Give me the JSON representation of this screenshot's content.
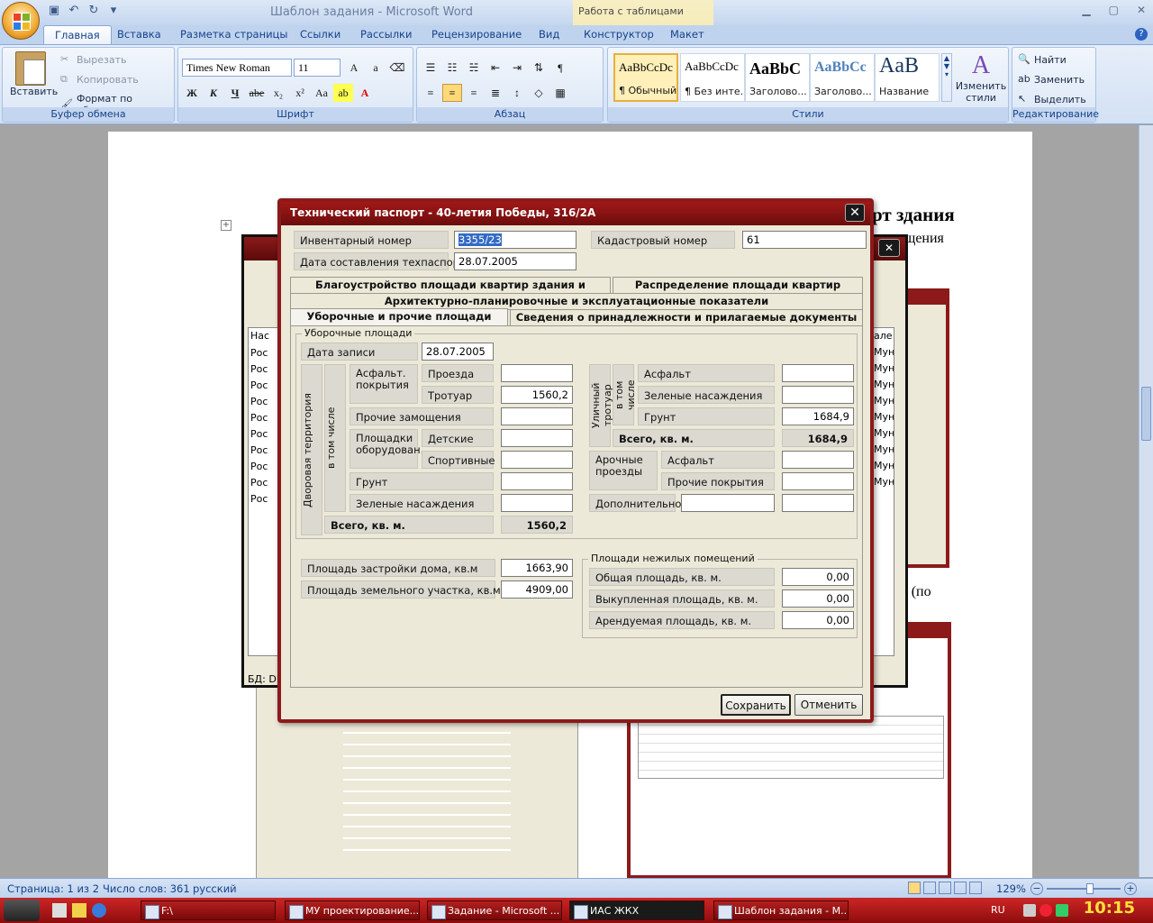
{
  "word": {
    "title": "Шаблон задания - Microsoft Word",
    "context_tab_title": "Работа с таблицами",
    "tabs": [
      "Главная",
      "Вставка",
      "Разметка страницы",
      "Ссылки",
      "Рассылки",
      "Рецензирование",
      "Вид",
      "Конструктор",
      "Макет"
    ],
    "clipboard": {
      "paste": "Вставить",
      "cut": "Вырезать",
      "copy": "Копировать",
      "format_painter": "Формат по образцу",
      "label": "Буфер обмена"
    },
    "font": {
      "name": "Times New Roman",
      "size": "11",
      "bold": "Ж",
      "italic": "К",
      "underline": "Ч",
      "strike": "abe",
      "label": "Шрифт"
    },
    "paragraph": {
      "label": "Абзац"
    },
    "styles": [
      {
        "sample": "AaBbCcDc",
        "name": "¶ Обычный"
      },
      {
        "sample": "AaBbCcDc",
        "name": "¶ Без инте..."
      },
      {
        "sample": "AaBbC",
        "name": "Заголово..."
      },
      {
        "sample": "AaBbCc",
        "name": "Заголово..."
      },
      {
        "sample": "AaB",
        "name": "Название"
      }
    ],
    "styles_label": "Стили",
    "change_styles": "Изменить стили",
    "editing": {
      "find": "Найти",
      "replace": "Заменить",
      "select": "Выделить",
      "label": "Редактирование"
    },
    "doc_fragments": {
      "heading_right": "рт здания",
      "sub_right": "щения",
      "mid_right": "дания (по"
    }
  },
  "dialog": {
    "title": "Технический паспорт - 40-летия Победы, 316/2А",
    "inv_label": "Инвентарный номер",
    "inv_value": "3355/23",
    "cad_label": "Кадастровый номер",
    "cad_value": "61",
    "date_label": "Дата составления техпаспорта",
    "date_value": "28.07.2005",
    "tabs_row1": [
      "Благоустройство площади квартир здания и строения",
      "Распределение площади квартир здания"
    ],
    "tabs_row2": [
      "Архитектурно-планировочные и эксплуатационные показатели"
    ],
    "tabs_row3": [
      "Уборочные и прочие площади",
      "Сведения о принадлежности и прилагаемые документы"
    ],
    "group_title": "Уборочные площади",
    "record_date_label": "Дата записи",
    "record_date_value": "28.07.2005",
    "yard": {
      "vertical": "Дворовая территория",
      "incl": "в том числе",
      "asphalt_group": "Асфальт. покрытия",
      "passages": "Проезда",
      "passages_value": "",
      "sidewalk": "Тротуар",
      "sidewalk_value": "1560,2",
      "other_paving": "Прочие замощения",
      "other_paving_value": "",
      "equipped": "Площадки оборудован.",
      "children": "Детские",
      "children_value": "",
      "sports": "Спортивные",
      "sports_value": "",
      "soil": "Грунт",
      "soil_value": "",
      "green": "Зеленые насаждения",
      "green_value": "",
      "total_label": "Всего, кв. м.",
      "total_value": "1560,2"
    },
    "street": {
      "vertical": "Уличный тротуар",
      "incl": "в том числе",
      "asphalt": "Асфальт",
      "asphalt_value": "",
      "green": "Зеленые насаждения",
      "green_value": "",
      "soil": "Грунт",
      "soil_value": "1684,9",
      "total_label": "Всего, кв. м.",
      "total_value": "1684,9"
    },
    "arch": {
      "label": "Арочные проезды",
      "asphalt": "Асфальт",
      "asphalt_value": "",
      "other": "Прочие покрытия",
      "other_value": ""
    },
    "extra_label": "Дополнительно",
    "extra_value1": "",
    "extra_value2": "",
    "build_area_label": "Площадь застройки дома, кв.м",
    "build_area_value": "1663,90",
    "land_area_label": "Площадь земельного участка, кв.м",
    "land_area_value": "4909,00",
    "nonres": {
      "title": "Площади нежилых помещений",
      "total_label": "Общая площадь, кв. м.",
      "total_value": "0,00",
      "bought_label": "Выкупленная площадь, кв. м.",
      "bought_value": "0,00",
      "rented_label": "Арендуемая площадь, кв. м.",
      "rented_value": "0,00"
    },
    "save": "Сохранить",
    "cancel": "Отменить"
  },
  "bg_window": {
    "col_header": "Нас",
    "row_text": "Рос",
    "right_col_header": "але",
    "right_text": "Муні",
    "db_label": "БД: DB"
  },
  "status": {
    "page": "Страница: 1 из 2",
    "words": "Число слов: 361",
    "lang": "русский",
    "zoom": "129%"
  },
  "taskbar": {
    "items": [
      "F:\\",
      "МУ проектирование...",
      "Задание - Microsoft ...",
      "ИАС ЖКХ",
      "Шаблон задания - M..."
    ],
    "lang": "RU",
    "clock": "10:15"
  }
}
